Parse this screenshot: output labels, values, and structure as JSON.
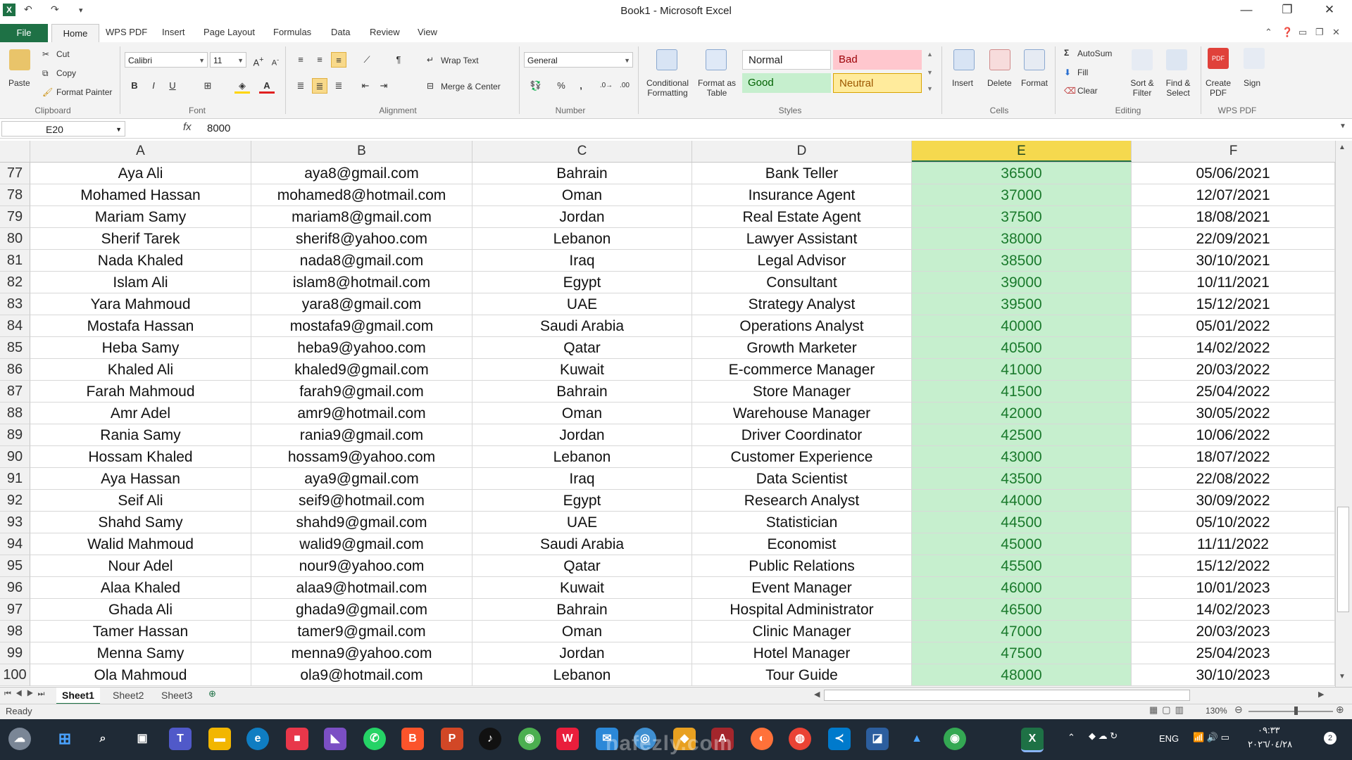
{
  "window": {
    "title": "Book1  -  Microsoft Excel",
    "quick_access": {
      "undo": "↶",
      "redo": "↷",
      "customize": "▾"
    },
    "controls": {
      "minimize": "—",
      "restore": "❐",
      "close": "✕"
    }
  },
  "tabs": {
    "file": "File",
    "items": [
      "Home",
      "WPS PDF",
      "Insert",
      "Page Layout",
      "Formulas",
      "Data",
      "Review",
      "View"
    ]
  },
  "ribbon": {
    "clipboard": {
      "paste": "Paste",
      "cut": "Cut",
      "copy": "Copy",
      "format_painter": "Format Painter",
      "label": "Clipboard"
    },
    "font": {
      "name": "Calibri",
      "size": "11",
      "bold": "B",
      "italic": "I",
      "underline": "U",
      "label": "Font"
    },
    "alignment": {
      "wrap_text": "Wrap Text",
      "merge_center": "Merge & Center",
      "label": "Alignment"
    },
    "number": {
      "format": "General",
      "percent": "%",
      "comma": ",",
      "label": "Number"
    },
    "styles": {
      "conditional": [
        "Conditional",
        "Formatting"
      ],
      "format_table": [
        "Format as",
        "Table"
      ],
      "normal": "Normal",
      "bad": "Bad",
      "good": "Good",
      "neutral": "Neutral",
      "label": "Styles"
    },
    "cells": {
      "insert": "Insert",
      "delete": "Delete",
      "format": "Format",
      "label": "Cells"
    },
    "editing": {
      "autosum": "AutoSum",
      "fill": "Fill",
      "clear": "Clear",
      "sort": [
        "Sort &",
        "Filter"
      ],
      "find": [
        "Find &",
        "Select"
      ],
      "label": "Editing"
    },
    "wpspdf": {
      "create": [
        "Create",
        "PDF"
      ],
      "sign": "Sign",
      "label": "WPS PDF"
    }
  },
  "formula_bar": {
    "name_box": "E20",
    "fx": "fx",
    "value": "8000"
  },
  "columns": [
    "A",
    "B",
    "C",
    "D",
    "E",
    "F"
  ],
  "selected_column": "E",
  "rows": [
    {
      "n": "77",
      "a": "Aya Ali",
      "b": "aya8@gmail.com",
      "c": "Bahrain",
      "d": "Bank Teller",
      "e": "36500",
      "f": "05/06/2021"
    },
    {
      "n": "78",
      "a": "Mohamed Hassan",
      "b": "mohamed8@hotmail.com",
      "c": "Oman",
      "d": "Insurance Agent",
      "e": "37000",
      "f": "12/07/2021"
    },
    {
      "n": "79",
      "a": "Mariam Samy",
      "b": "mariam8@gmail.com",
      "c": "Jordan",
      "d": "Real Estate Agent",
      "e": "37500",
      "f": "18/08/2021"
    },
    {
      "n": "80",
      "a": "Sherif Tarek",
      "b": "sherif8@yahoo.com",
      "c": "Lebanon",
      "d": "Lawyer Assistant",
      "e": "38000",
      "f": "22/09/2021"
    },
    {
      "n": "81",
      "a": "Nada Khaled",
      "b": "nada8@gmail.com",
      "c": "Iraq",
      "d": "Legal Advisor",
      "e": "38500",
      "f": "30/10/2021"
    },
    {
      "n": "82",
      "a": "Islam Ali",
      "b": "islam8@hotmail.com",
      "c": "Egypt",
      "d": "Consultant",
      "e": "39000",
      "f": "10/11/2021"
    },
    {
      "n": "83",
      "a": "Yara Mahmoud",
      "b": "yara8@gmail.com",
      "c": "UAE",
      "d": "Strategy Analyst",
      "e": "39500",
      "f": "15/12/2021"
    },
    {
      "n": "84",
      "a": "Mostafa Hassan",
      "b": "mostafa9@gmail.com",
      "c": "Saudi Arabia",
      "d": "Operations Analyst",
      "e": "40000",
      "f": "05/01/2022"
    },
    {
      "n": "85",
      "a": "Heba Samy",
      "b": "heba9@yahoo.com",
      "c": "Qatar",
      "d": "Growth Marketer",
      "e": "40500",
      "f": "14/02/2022"
    },
    {
      "n": "86",
      "a": "Khaled Ali",
      "b": "khaled9@gmail.com",
      "c": "Kuwait",
      "d": "E-commerce Manager",
      "e": "41000",
      "f": "20/03/2022"
    },
    {
      "n": "87",
      "a": "Farah Mahmoud",
      "b": "farah9@gmail.com",
      "c": "Bahrain",
      "d": "Store Manager",
      "e": "41500",
      "f": "25/04/2022"
    },
    {
      "n": "88",
      "a": "Amr Adel",
      "b": "amr9@hotmail.com",
      "c": "Oman",
      "d": "Warehouse Manager",
      "e": "42000",
      "f": "30/05/2022"
    },
    {
      "n": "89",
      "a": "Rania Samy",
      "b": "rania9@gmail.com",
      "c": "Jordan",
      "d": "Driver Coordinator",
      "e": "42500",
      "f": "10/06/2022"
    },
    {
      "n": "90",
      "a": "Hossam Khaled",
      "b": "hossam9@yahoo.com",
      "c": "Lebanon",
      "d": "Customer Experience",
      "e": "43000",
      "f": "18/07/2022"
    },
    {
      "n": "91",
      "a": "Aya Hassan",
      "b": "aya9@gmail.com",
      "c": "Iraq",
      "d": "Data Scientist",
      "e": "43500",
      "f": "22/08/2022"
    },
    {
      "n": "92",
      "a": "Seif Ali",
      "b": "seif9@hotmail.com",
      "c": "Egypt",
      "d": "Research Analyst",
      "e": "44000",
      "f": "30/09/2022"
    },
    {
      "n": "93",
      "a": "Shahd Samy",
      "b": "shahd9@gmail.com",
      "c": "UAE",
      "d": "Statistician",
      "e": "44500",
      "f": "05/10/2022"
    },
    {
      "n": "94",
      "a": "Walid Mahmoud",
      "b": "walid9@gmail.com",
      "c": "Saudi Arabia",
      "d": "Economist",
      "e": "45000",
      "f": "11/11/2022"
    },
    {
      "n": "95",
      "a": "Nour Adel",
      "b": "nour9@yahoo.com",
      "c": "Qatar",
      "d": "Public Relations",
      "e": "45500",
      "f": "15/12/2022"
    },
    {
      "n": "96",
      "a": "Alaa Khaled",
      "b": "alaa9@hotmail.com",
      "c": "Kuwait",
      "d": "Event Manager",
      "e": "46000",
      "f": "10/01/2023"
    },
    {
      "n": "97",
      "a": "Ghada Ali",
      "b": "ghada9@gmail.com",
      "c": "Bahrain",
      "d": "Hospital Administrator",
      "e": "46500",
      "f": "14/02/2023"
    },
    {
      "n": "98",
      "a": "Tamer Hassan",
      "b": "tamer9@gmail.com",
      "c": "Oman",
      "d": "Clinic Manager",
      "e": "47000",
      "f": "20/03/2023"
    },
    {
      "n": "99",
      "a": "Menna Samy",
      "b": "menna9@yahoo.com",
      "c": "Jordan",
      "d": "Hotel Manager",
      "e": "47500",
      "f": "25/04/2023"
    },
    {
      "n": "100",
      "a": "Ola Mahmoud",
      "b": "ola9@hotmail.com",
      "c": "Lebanon",
      "d": "Tour Guide",
      "e": "48000",
      "f": "30/10/2023"
    }
  ],
  "sheets": [
    "Sheet1",
    "Sheet2",
    "Sheet3"
  ],
  "active_sheet": "Sheet1",
  "status": {
    "text": "Ready",
    "zoom": "130%"
  },
  "taskbar": {
    "language": "ENG",
    "time": "٠٩:٣٣",
    "date": "٢٠٢٦/٠٤/٢٨",
    "notification_count": "2",
    "watermark": "nafezly.com"
  },
  "colors": {
    "excel_green": "#1e7145",
    "good_fill": "#c6efce",
    "good_text": "#1a7a2c",
    "bad_fill": "#ffc7ce",
    "neutral_fill": "#ffeb9c",
    "selected_header": "#f5d94e"
  }
}
